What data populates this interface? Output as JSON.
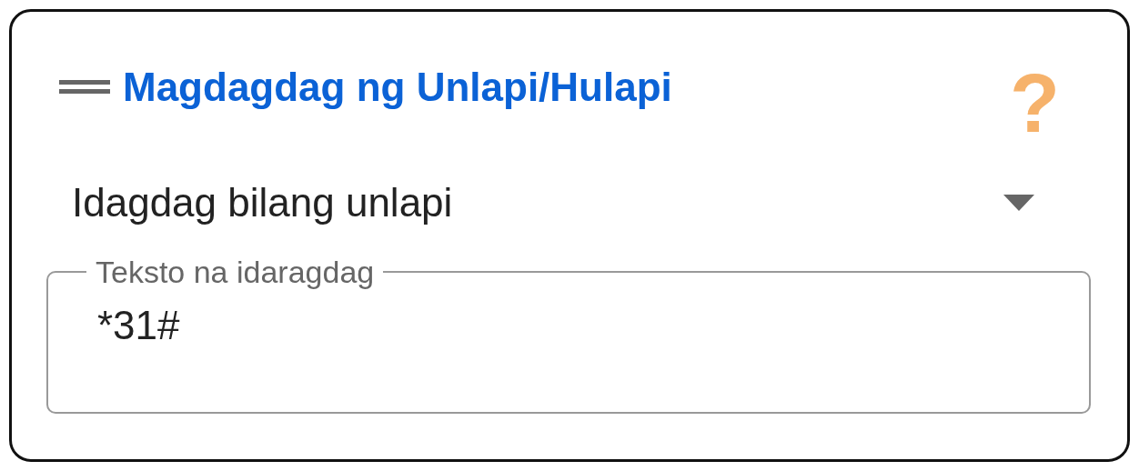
{
  "card": {
    "title": "Magdagdag ng Unlapi/Hulapi",
    "help": "?"
  },
  "dropdown": {
    "value": "Idagdag bilang unlapi"
  },
  "text_field": {
    "label": "Teksto na idaragdag",
    "value": "*31#"
  }
}
